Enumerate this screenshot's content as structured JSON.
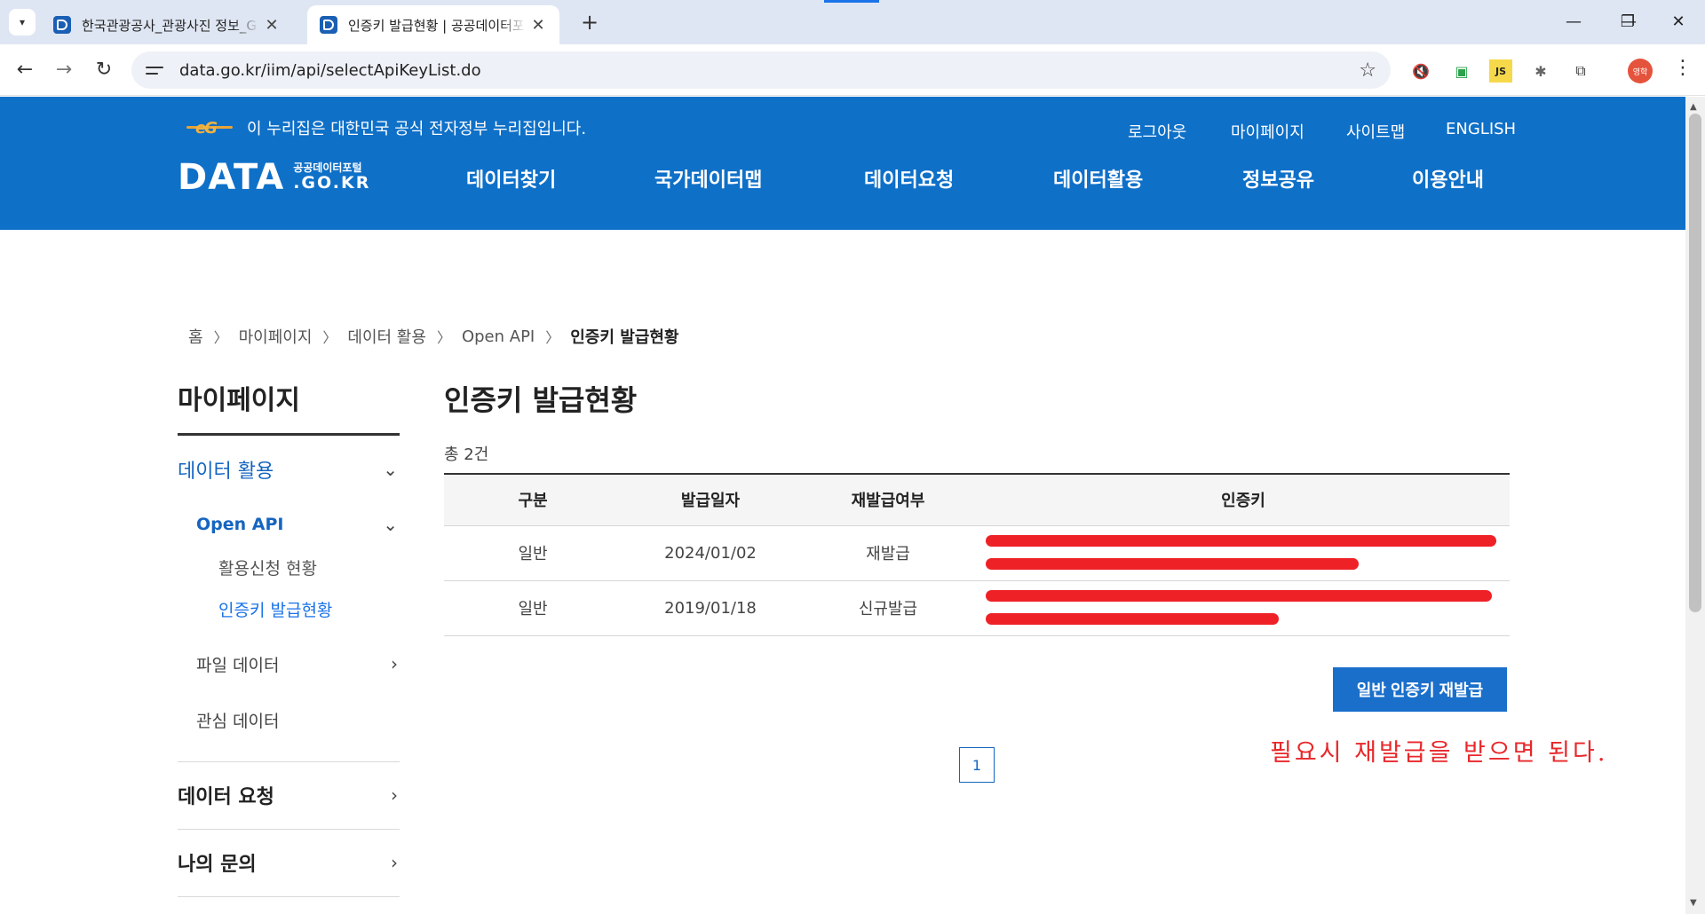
{
  "browser": {
    "tabs": [
      {
        "title": "한국관광공사_관광사진 정보_G",
        "active": false
      },
      {
        "title": "인증키 발급현황 | 공공데이터포",
        "active": true
      }
    ],
    "url": "data.go.kr/iim/api/selectApiKeyList.do",
    "profile_label": "영학",
    "extensions": [
      "mic-off-icon",
      "screen-icon",
      "js-icon",
      "bug-icon",
      "puzzle-icon"
    ]
  },
  "header": {
    "gov_notice": "이 누리집은 대한민국 공식 전자정부 누리집입니다.",
    "gov_logo_text": "eG",
    "util_links": [
      "로그아웃",
      "마이페이지",
      "사이트맵",
      "ENGLISH"
    ],
    "brand": {
      "main": "DATA",
      "sub_ko": "공공데이터포털",
      "sub_en": ".GO.KR"
    },
    "gnb": [
      "데이터찾기",
      "국가데이터맵",
      "데이터요청",
      "데이터활용",
      "정보공유",
      "이용안내"
    ],
    "bg_color": "#0f70c8"
  },
  "breadcrumb": [
    "홈",
    "마이페이지",
    "데이터 활용",
    "Open API",
    "인증키 발급현황"
  ],
  "sidebar": {
    "title": "마이페이지",
    "data_use": "데이터 활용",
    "open_api": "Open API",
    "open_api_children": [
      "활용신청 현황",
      "인증키 발급현황"
    ],
    "file_data": "파일 데이터",
    "interest_data": "관심 데이터",
    "data_request": "데이터 요청",
    "my_inquiry": "나의 문의"
  },
  "main": {
    "title": "인증키 발급현황",
    "total": "총 2건",
    "columns": [
      "구분",
      "발급일자",
      "재발급여부",
      "인증키"
    ],
    "rows": [
      {
        "type": "일반",
        "date": "2024/01/02",
        "reissue": "재발급"
      },
      {
        "type": "일반",
        "date": "2019/01/18",
        "reissue": "신규발급"
      }
    ],
    "reissue_button": "일반 인증키 재발급",
    "page": "1",
    "annotation": "필요시 재발급을 받으면 된다."
  },
  "colors": {
    "accent": "#1a6fcb",
    "annotation": "#e8272a",
    "redaction": "#ee2127"
  }
}
